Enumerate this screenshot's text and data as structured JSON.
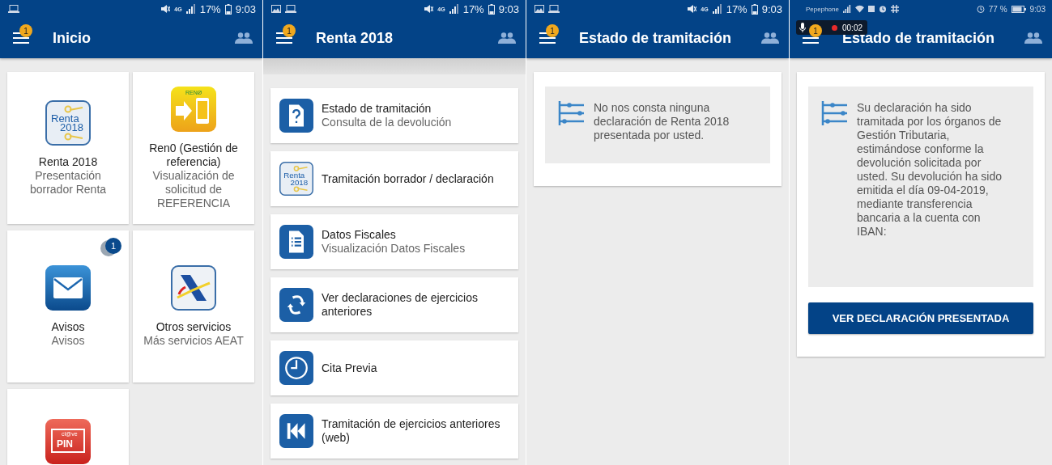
{
  "screens": [
    {
      "kind": "home",
      "status_bar": {
        "kind": "samsung",
        "image_notification": false,
        "network": "4G",
        "battery": "17%",
        "time": "9:03"
      },
      "app_bar": {
        "title": "Inicio",
        "badge": "1"
      },
      "tiles": [
        {
          "kind": "renta",
          "logo_lines": [
            "Renta",
            "2018"
          ],
          "title": "Renta 2018",
          "subtitle": "Presentación borrador Renta"
        },
        {
          "kind": "ren0",
          "logo_lines": [
            "RENØ"
          ],
          "title": "Ren0 (Gestión de referencia)",
          "subtitle": "Visualización de solicitud de REFERENCIA"
        },
        {
          "kind": "mail",
          "badge": "1",
          "title": "Avisos",
          "subtitle": "Avisos"
        },
        {
          "kind": "aeat",
          "title": "Otros servicios",
          "subtitle": "Más servicios AEAT"
        },
        {
          "kind": "clave",
          "logo_lines": [
            "cl@ve",
            "PIN"
          ]
        }
      ]
    },
    {
      "kind": "menu",
      "status_bar": {
        "kind": "samsung",
        "image_notification": true,
        "network": "4G",
        "battery": "17%",
        "time": "9:03"
      },
      "app_bar": {
        "title": "Renta 2018",
        "badge": "1"
      },
      "items": [
        {
          "kind": "question",
          "title": "Estado de tramitación",
          "subtitle": "Consulta de la devolución"
        },
        {
          "kind": "renta",
          "logo_lines": [
            "Renta",
            "2018"
          ],
          "title": "Tramitación borrador / declaración"
        },
        {
          "kind": "list",
          "title": "Datos Fiscales",
          "subtitle": "Visualización Datos Fiscales"
        },
        {
          "kind": "exchange",
          "title": "Ver declaraciones de ejercicios anteriores"
        },
        {
          "kind": "clock",
          "title": "Cita Previa"
        },
        {
          "kind": "rewind",
          "title": "Tramitación de ejercicios anteriores (web)"
        }
      ]
    },
    {
      "kind": "status",
      "status_bar": {
        "kind": "samsung",
        "image_notification": true,
        "network": "4G",
        "battery": "17%",
        "time": "9:03"
      },
      "app_bar": {
        "title": "Estado de tramitación",
        "badge": "1"
      },
      "message": "No nos consta ninguna declaración de Renta 2018 presentada por usted."
    },
    {
      "kind": "status",
      "status_bar": {
        "kind": "carrier",
        "carrier": "Pepephone",
        "battery": "77 %",
        "time": "9:03"
      },
      "app_bar": {
        "title": "Estado de tramitación",
        "badge": "1"
      },
      "recording": {
        "time": "00:02"
      },
      "message": "Su declaración ha sido tramitada por los órganos de Gestión Tributaria, estimándose conforme la devolución solicitada por usted. Su devolución ha sido emitida el día 09-04-2019, mediante transferencia bancaria a la cuenta con IBAN:",
      "button": "VER DECLARACIÓN PRESENTADA"
    }
  ]
}
